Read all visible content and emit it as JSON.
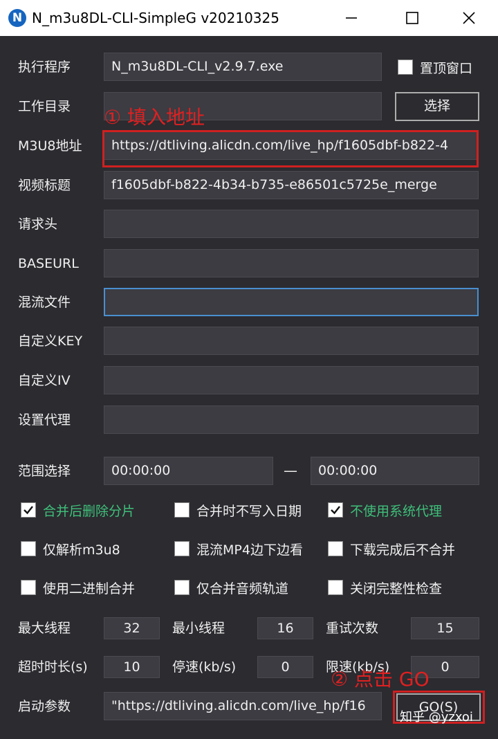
{
  "window": {
    "title": "N_m3u8DL-CLI-SimpleG v20210325",
    "icon_letter": "N"
  },
  "form": {
    "exec": {
      "label": "执行程序",
      "value": "N_m3u8DL-CLI_v2.9.7.exe"
    },
    "topmost": {
      "label": "置顶窗口",
      "checked": false
    },
    "workdir": {
      "label": "工作目录",
      "value": ""
    },
    "choose_button": "选择",
    "m3u8": {
      "label": "M3U8地址",
      "value": "https://dtliving.alicdn.com/live_hp/f1605dbf-b822-4"
    },
    "title": {
      "label": "视频标题",
      "value": "f1605dbf-b822-4b34-b735-e86501c5725e_merge"
    },
    "headers": {
      "label": "请求头",
      "value": ""
    },
    "baseurl": {
      "label": "BASEURL",
      "value": ""
    },
    "mux": {
      "label": "混流文件",
      "value": ""
    },
    "key": {
      "label": "自定义KEY",
      "value": ""
    },
    "iv": {
      "label": "自定义IV",
      "value": ""
    },
    "proxy": {
      "label": "设置代理",
      "value": ""
    },
    "range": {
      "label": "范围选择",
      "start": "00:00:00",
      "dash": "—",
      "end": "00:00:00"
    }
  },
  "options": [
    {
      "label": "合并后删除分片",
      "checked": true,
      "accent": "#3fc07a"
    },
    {
      "label": "合并时不写入日期",
      "checked": false
    },
    {
      "label": "不使用系统代理",
      "checked": true,
      "accent": "#3fc07a"
    },
    {
      "label": "仅解析m3u8",
      "checked": false
    },
    {
      "label": "混流MP4边下边看",
      "checked": false
    },
    {
      "label": "下载完成后不合并",
      "checked": false
    },
    {
      "label": "使用二进制合并",
      "checked": false
    },
    {
      "label": "仅合并音频轨道",
      "checked": false
    },
    {
      "label": "关闭完整性检查",
      "checked": false
    }
  ],
  "params": {
    "max_threads": {
      "label": "最大线程",
      "value": "32"
    },
    "min_threads": {
      "label": "最小线程",
      "value": "16"
    },
    "retries": {
      "label": "重试次数",
      "value": "15"
    },
    "timeout": {
      "label": "超时时长(s)",
      "value": "10"
    },
    "stop_speed": {
      "label": "停速(kb/s)",
      "value": "0"
    },
    "limit_speed": {
      "label": "限速(kb/s)",
      "value": "0"
    }
  },
  "launch": {
    "label": "启动参数",
    "value": "\"https://dtliving.alicdn.com/live_hp/f16",
    "go_button": "GO(S)"
  },
  "annotations": {
    "step1": "① 填入地址",
    "step2": "② 点击 GO"
  },
  "watermark": "知乎 @yzxoi"
}
